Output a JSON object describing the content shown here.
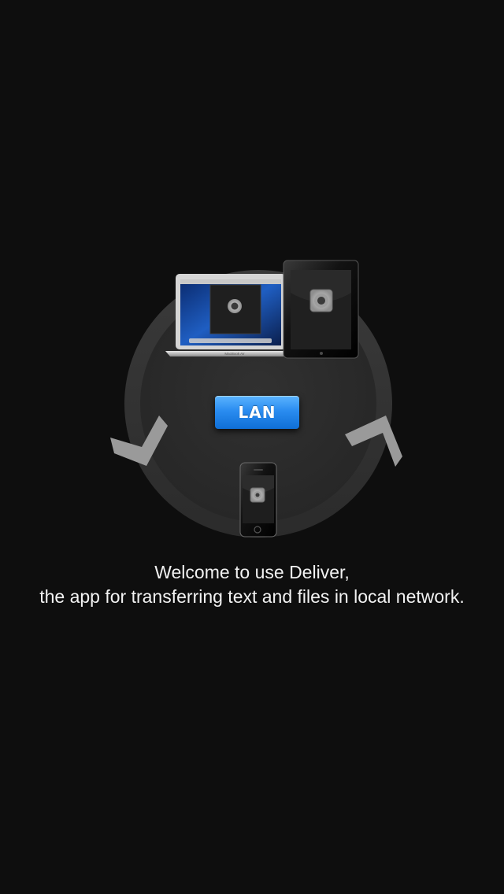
{
  "illustration": {
    "lan_label": "LAN",
    "laptop_brand": "MacBook Air",
    "devices": [
      "laptop",
      "tablet",
      "phone"
    ],
    "app_icon": "speaker-icon"
  },
  "welcome": {
    "line1": "Welcome to use Deliver,",
    "line2": "the app for transferring text and files in local network."
  },
  "colors": {
    "background": "#0e0e0e",
    "ring": "#2f2f2f",
    "lan_accent": "#2a8cf0",
    "arrow": "#9a9a9a"
  }
}
